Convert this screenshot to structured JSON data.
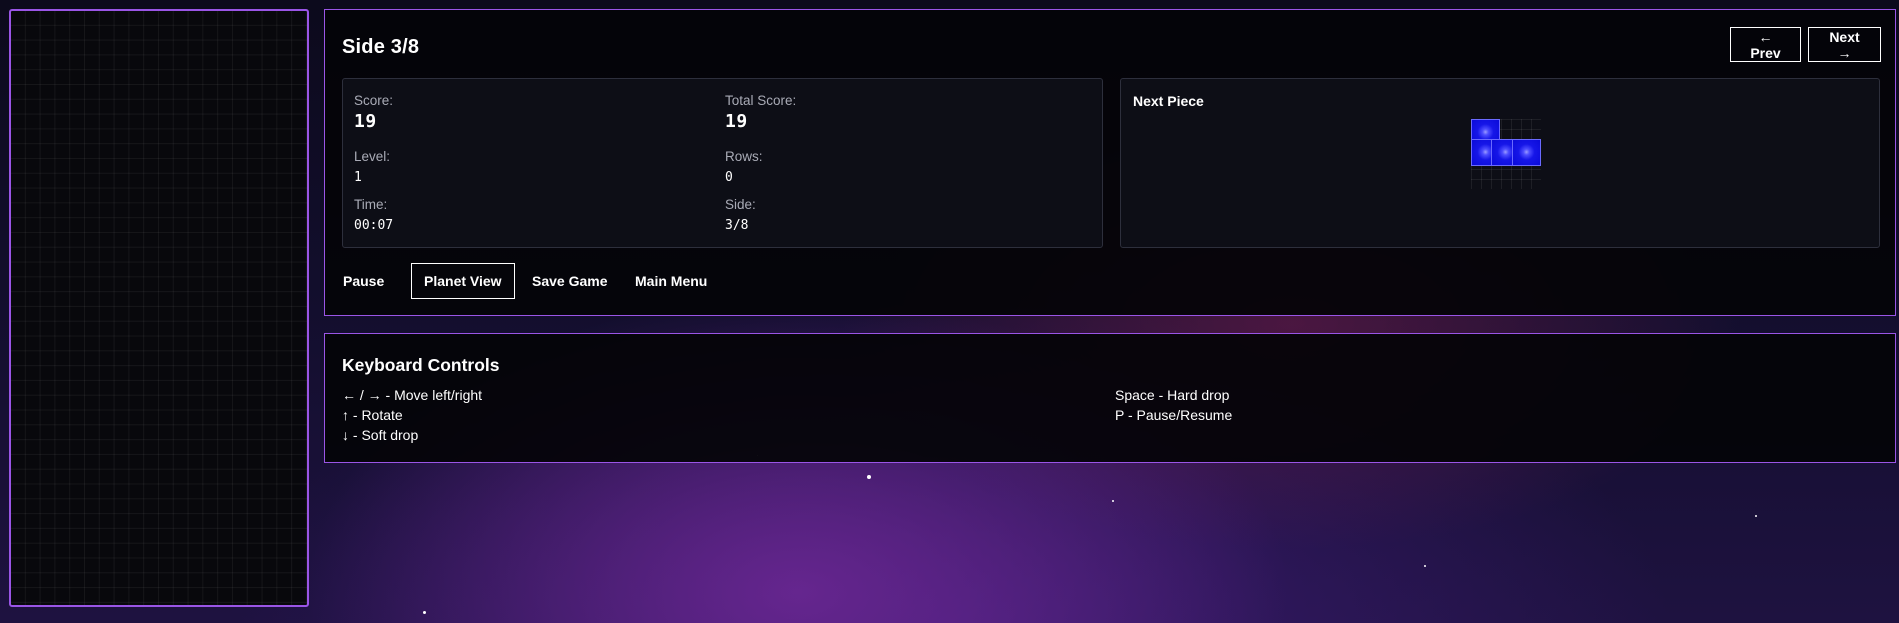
{
  "side": {
    "title": "Side 3/8",
    "prev_label": "← Prev",
    "next_label": "Next →"
  },
  "stats": {
    "score_label": "Score:",
    "score_value": "19",
    "total_label": "Total Score:",
    "total_value": "19",
    "level_label": "Level:",
    "level_value": "1",
    "rows_label": "Rows:",
    "rows_value": "0",
    "time_label": "Time:",
    "time_value": "00:07",
    "side_label": "Side:",
    "side_value": "3/8"
  },
  "next_piece": {
    "title": "Next Piece",
    "shape": "J",
    "color": "#1010e6"
  },
  "actions": {
    "pause": "Pause",
    "planet_view": "Planet View",
    "save_game": "Save Game",
    "main_menu": "Main Menu"
  },
  "controls": {
    "title": "Keyboard Controls",
    "left": [
      "← / → - Move left/right",
      "↑ - Rotate",
      "↓ - Soft drop"
    ],
    "right": [
      "Space - Hard drop",
      "P - Pause/Resume"
    ]
  },
  "colors": {
    "accent": "#9a55e6",
    "piece": "#1010e6"
  }
}
